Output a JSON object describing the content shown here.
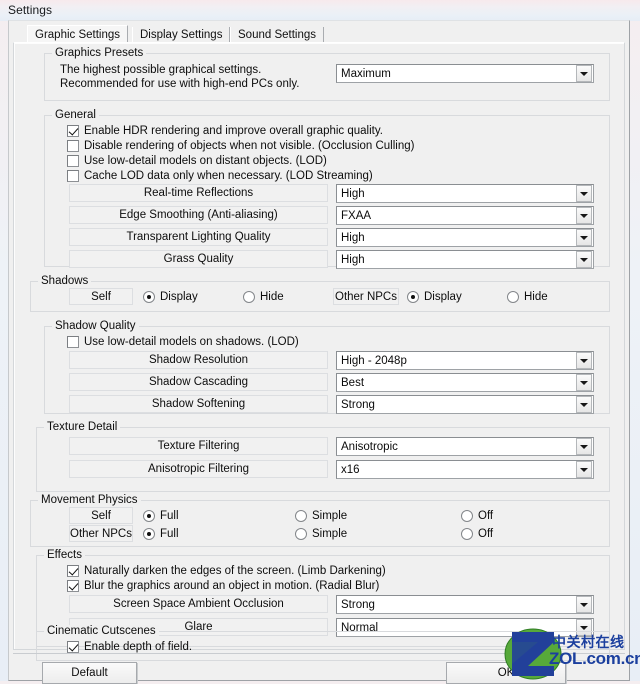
{
  "window": {
    "title": "Settings"
  },
  "tabs": [
    {
      "label": "Graphic Settings",
      "active": true
    },
    {
      "label": "Display Settings",
      "active": false
    },
    {
      "label": "Sound Settings",
      "active": false
    }
  ],
  "groups": {
    "presets": {
      "legend": "Graphics Presets",
      "description": "The highest possible graphical settings. Recommended for use with high-end PCs only.",
      "preset_value": "Maximum"
    },
    "general": {
      "legend": "General",
      "checkboxes": [
        {
          "label": "Enable HDR rendering and improve overall graphic quality.",
          "checked": true
        },
        {
          "label": "Disable rendering of objects when not visible. (Occlusion Culling)",
          "checked": false
        },
        {
          "label": "Use low-detail models on distant objects. (LOD)",
          "checked": false
        },
        {
          "label": "Cache LOD data only when necessary. (LOD Streaming)",
          "checked": false
        }
      ],
      "rows": [
        {
          "label": "Real-time Reflections",
          "value": "High"
        },
        {
          "label": "Edge Smoothing (Anti-aliasing)",
          "value": "FXAA"
        },
        {
          "label": "Transparent Lighting Quality",
          "value": "High"
        },
        {
          "label": "Grass Quality",
          "value": "High"
        }
      ]
    },
    "shadows": {
      "legend": "Shadows",
      "rows": [
        {
          "tag": "Self",
          "options": [
            {
              "label": "Display",
              "selected": true
            },
            {
              "label": "Hide",
              "selected": false
            }
          ]
        },
        {
          "tag": "Other NPCs",
          "options": [
            {
              "label": "Display",
              "selected": true
            },
            {
              "label": "Hide",
              "selected": false
            }
          ]
        }
      ]
    },
    "shadow_quality": {
      "legend": "Shadow Quality",
      "checkboxes": [
        {
          "label": "Use low-detail models on shadows. (LOD)",
          "checked": false
        }
      ],
      "rows": [
        {
          "label": "Shadow Resolution",
          "value": "High - 2048p"
        },
        {
          "label": "Shadow Cascading",
          "value": "Best"
        },
        {
          "label": "Shadow Softening",
          "value": "Strong"
        }
      ]
    },
    "texture_detail": {
      "legend": "Texture Detail",
      "rows": [
        {
          "label": "Texture Filtering",
          "value": "Anisotropic"
        },
        {
          "label": "Anisotropic Filtering",
          "value": "x16"
        }
      ]
    },
    "movement_physics": {
      "legend": "Movement Physics",
      "rows": [
        {
          "tag": "Self",
          "options": [
            {
              "label": "Full",
              "selected": true
            },
            {
              "label": "Simple",
              "selected": false
            },
            {
              "label": "Off",
              "selected": false
            }
          ]
        },
        {
          "tag": "Other NPCs",
          "options": [
            {
              "label": "Full",
              "selected": true
            },
            {
              "label": "Simple",
              "selected": false
            },
            {
              "label": "Off",
              "selected": false
            }
          ]
        }
      ]
    },
    "effects": {
      "legend": "Effects",
      "checkboxes": [
        {
          "label": "Naturally darken the edges of the screen. (Limb Darkening)",
          "checked": true
        },
        {
          "label": "Blur the graphics around an object in motion. (Radial Blur)",
          "checked": true
        }
      ],
      "rows": [
        {
          "label": "Screen Space Ambient Occlusion",
          "value": "Strong"
        },
        {
          "label": "Glare",
          "value": "Normal"
        }
      ]
    },
    "cinematic": {
      "legend": "Cinematic Cutscenes",
      "checkboxes": [
        {
          "label": "Enable depth of field.",
          "checked": true
        }
      ]
    }
  },
  "footer": {
    "default_label": "Default",
    "ok_label": "OK"
  },
  "watermark": {
    "chinese": "中关村在线",
    "english": "ZOL.com.cn",
    "logo_letter": "Z",
    "color_blue": "#1b3f9e",
    "color_green": "#5aab3c"
  }
}
